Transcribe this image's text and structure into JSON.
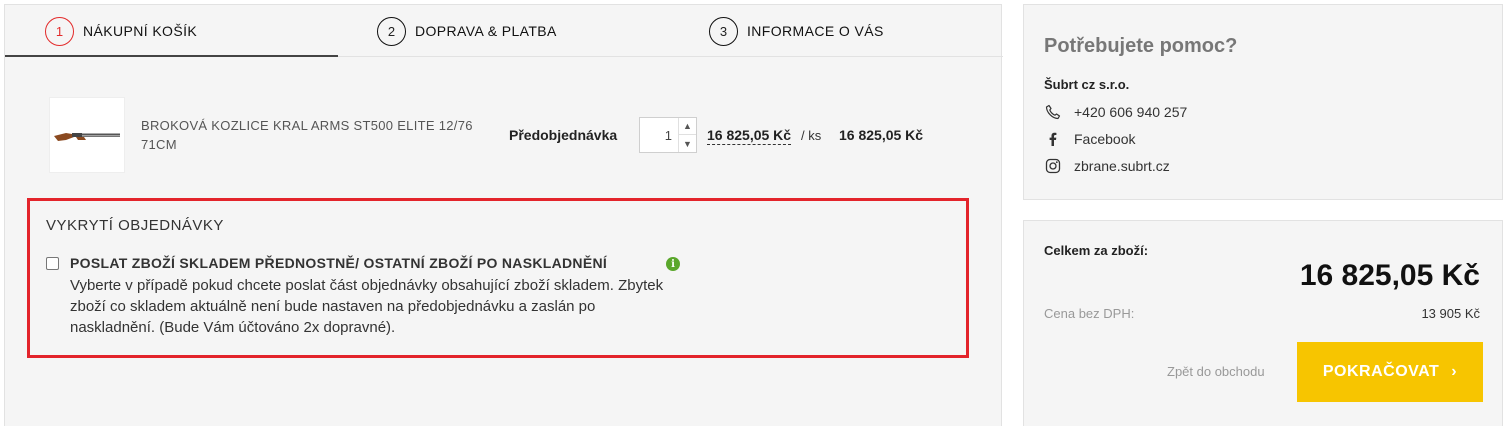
{
  "steps": [
    {
      "number": "1",
      "label": "NÁKUPNÍ KOŠÍK"
    },
    {
      "number": "2",
      "label": "DOPRAVA & PLATBA"
    },
    {
      "number": "3",
      "label": "INFORMACE O VÁS"
    }
  ],
  "cart": {
    "item": {
      "name": "BROKOVÁ KOZLICE KRAL ARMS ST500 ELITE 12/76 71CM",
      "availability": "Předobjednávka",
      "quantity": "1",
      "unit_price": "16 825,05 Kč",
      "per_unit": "/ ks",
      "total": "16 825,05 Kč"
    }
  },
  "fulfillment": {
    "title": "VYKRYTÍ OBJEDNÁVKY",
    "option_label": "POSLAT ZBOŽÍ SKLADEM PŘEDNOSTNĚ/ OSTATNÍ ZBOŽÍ PO NASKLADNĚNÍ",
    "info_icon_text": "i",
    "description": "Vyberte v případě pokud chcete poslat část objednávky obsahující zboží skladem. Zbytek zboží co skladem aktuálně není bude nastaven na předobjednávku a zaslán po naskladnění. (Bude Vám účtováno 2x dopravné)."
  },
  "help": {
    "title": "Potřebujete pomoc?",
    "company": "Šubrt cz s.r.o.",
    "phone": "+420 606 940 257",
    "facebook": "Facebook",
    "instagram": "zbrane.subrt.cz"
  },
  "summary": {
    "total_label": "Celkem za zboží:",
    "total_value": "16 825,05 Kč",
    "vat_label": "Cena bez DPH:",
    "vat_value": "13 905 Kč",
    "back_label": "Zpět do obchodu",
    "continue_label": "POKRAČOVAT"
  },
  "colors": {
    "accent": "#f7c500",
    "active_step": "#e32b2b",
    "highlight_border": "#e3242b",
    "info_green": "#5aa72b"
  }
}
